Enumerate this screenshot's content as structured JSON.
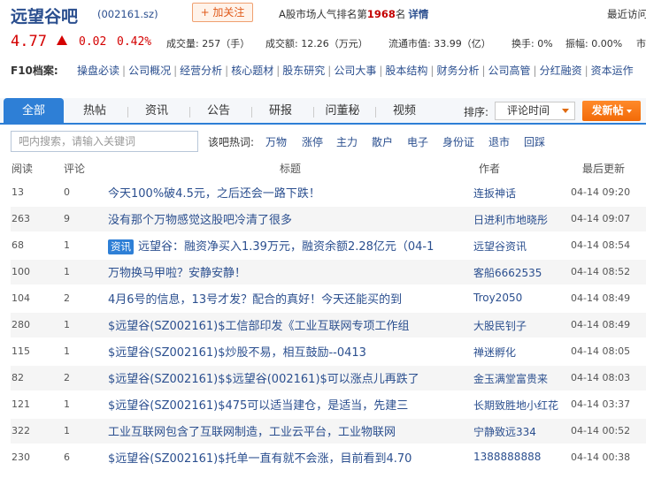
{
  "header": {
    "bar_name": "远望谷吧",
    "stock_code": "(002161.sz)",
    "follow_label": "+ 加关注",
    "rank_prefix": "A股市场人气排名第",
    "rank_number": "1968",
    "rank_suffix": "名",
    "rank_detail": "详情",
    "recent_visits": "最近访问"
  },
  "quote": {
    "price": "4.77",
    "change": "0.02",
    "change_pct": "0.42%",
    "volume": "成交量: 257（手）",
    "turnover": "成交额: 12.26（万元）",
    "float_mcap": "流通市值: 33.99（亿）",
    "turnover_rate": "换手: 0%",
    "amplitude": "振幅: 0.00%",
    "market_cut": "市"
  },
  "f10": {
    "label": "F10档案:",
    "links": [
      "操盘必读",
      "公司概况",
      "经营分析",
      "核心题材",
      "股东研究",
      "公司大事",
      "股本结构",
      "财务分析",
      "公司高管",
      "分红融资",
      "资本运作"
    ]
  },
  "tabs": [
    {
      "label": "全部",
      "active": true
    },
    {
      "label": "热帖"
    },
    {
      "label": "资讯"
    },
    {
      "label": "公告"
    },
    {
      "label": "研报"
    },
    {
      "label": "问董秘"
    },
    {
      "label": "视频"
    }
  ],
  "sort": {
    "label": "排序:",
    "value": "评论时间"
  },
  "post_button": "发新帖",
  "search": {
    "placeholder": "吧内搜索，请输入关键词"
  },
  "hot_words": {
    "label": "该吧热词:",
    "words": [
      "万物",
      "涨停",
      "主力",
      "散户",
      "电子",
      "身份证",
      "退市",
      "回踩"
    ]
  },
  "table": {
    "columns": {
      "read": "阅读",
      "reply": "评论",
      "title": "标题",
      "author": "作者",
      "updated": "最后更新"
    },
    "rows": [
      {
        "read": "13",
        "reply": "0",
        "title": "今天100%破4.5元，之后还会一路下跌！",
        "author": "连扳神话",
        "time": "04-14 09:20"
      },
      {
        "read": "263",
        "reply": "9",
        "title": "没有那个万物感觉这股吧冷清了很多",
        "author": "日进利市地晓彤",
        "time": "04-14 09:07"
      },
      {
        "read": "68",
        "reply": "1",
        "badge": "资讯",
        "title": "远望谷：融资净买入1.39万元，融资余额2.28亿元（04-1",
        "author": "远望谷资讯",
        "time": "04-14 08:54"
      },
      {
        "read": "100",
        "reply": "1",
        "title": "万物换马甲啦？安静安静！",
        "author": "客船6662535",
        "time": "04-14 08:52"
      },
      {
        "read": "104",
        "reply": "2",
        "title": "4月6号的信息，13号才发？配合的真好！今天还能买的到",
        "author": "Troy2050",
        "time": "04-14 08:49"
      },
      {
        "read": "280",
        "reply": "1",
        "title": "$远望谷(SZ002161)$工信部印发《工业互联网专项工作组",
        "author": "大股民钊子",
        "time": "04-14 08:49"
      },
      {
        "read": "115",
        "reply": "1",
        "title": "$远望谷(SZ002161)$炒股不易，相互鼓励--0413",
        "author": "禅迷孵化",
        "time": "04-14 08:05"
      },
      {
        "read": "82",
        "reply": "2",
        "title": "$远望谷(SZ002161)$$远望谷(002161)$可以涨点儿再跌了",
        "author": "金玉满堂富贵来",
        "time": "04-14 08:03"
      },
      {
        "read": "121",
        "reply": "1",
        "title": "$远望谷(SZ002161)$475可以适当建仓，是适当，先建三",
        "author": "长期致胜地小红花",
        "time": "04-14 03:37"
      },
      {
        "read": "322",
        "reply": "1",
        "title": "工业互联网包含了互联网制造，工业云平台，工业物联网",
        "author": "宁静致远334",
        "time": "04-14 00:52"
      },
      {
        "read": "230",
        "reply": "6",
        "title": "$远望谷(SZ002161)$托单一直有就不会涨，目前看到4.70",
        "author": "1388888888",
        "time": "04-14 00:38"
      }
    ]
  }
}
